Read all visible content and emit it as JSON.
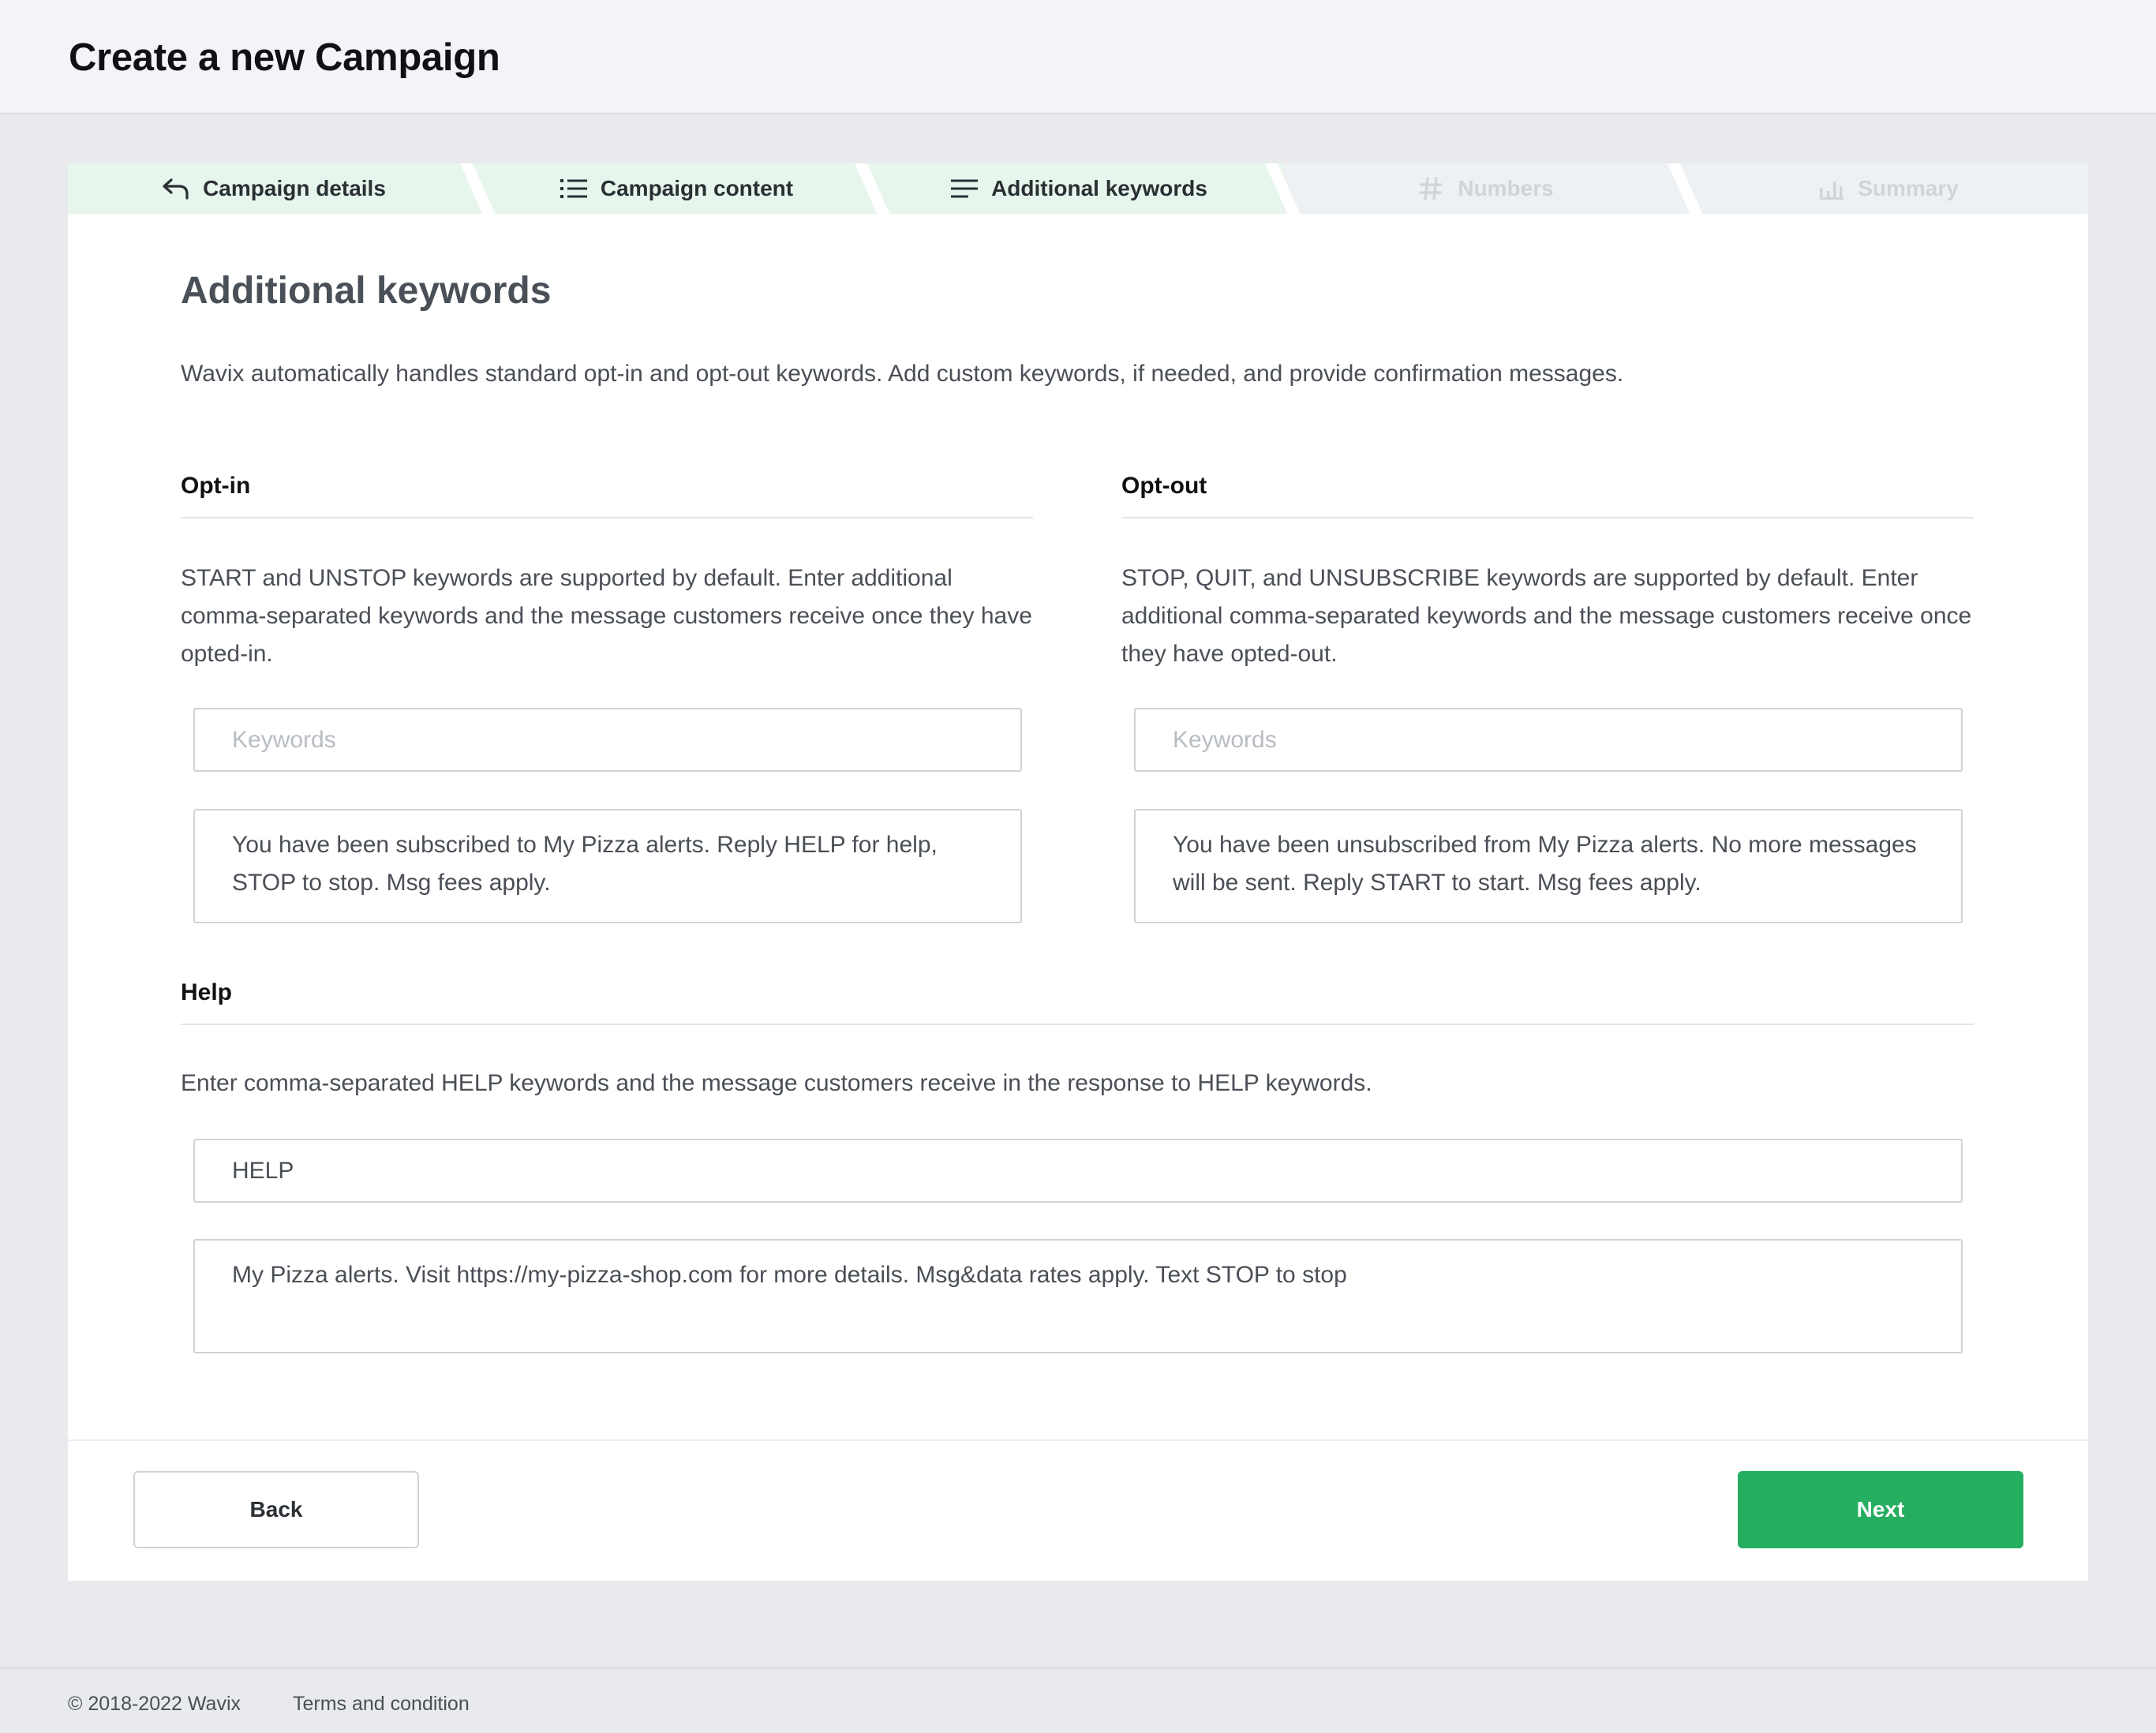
{
  "page": {
    "title": "Create a new Campaign"
  },
  "steps": [
    {
      "label": "Campaign details",
      "icon": "reply-arrow-icon",
      "state": "done"
    },
    {
      "label": "Campaign content",
      "icon": "list-icon",
      "state": "done"
    },
    {
      "label": "Additional keywords",
      "icon": "text-lines-icon",
      "state": "current"
    },
    {
      "label": "Numbers",
      "icon": "hash-icon",
      "state": "todo"
    },
    {
      "label": "Summary",
      "icon": "bar-chart-icon",
      "state": "todo"
    }
  ],
  "section": {
    "title": "Additional keywords",
    "intro": "Wavix automatically handles standard opt-in and opt-out keywords. Add custom keywords, if needed, and provide confirmation messages."
  },
  "optin": {
    "heading": "Opt-in",
    "description": "START and UNSTOP keywords are supported by default. Enter additional comma-separated keywords and the message customers receive once they have opted-in.",
    "keywords_placeholder": "Keywords",
    "keywords_value": "",
    "message": "You have been subscribed to My Pizza alerts. Reply HELP for help, STOP to stop. Msg fees apply."
  },
  "optout": {
    "heading": "Opt-out",
    "description": "STOP, QUIT, and UNSUBSCRIBE keywords are supported by default. Enter additional comma-separated keywords and the message customers receive once they have opted-out.",
    "keywords_placeholder": "Keywords",
    "keywords_value": "",
    "message": "You have been unsubscribed from My Pizza alerts. No more messages will be sent. Reply START to start. Msg fees apply."
  },
  "help": {
    "heading": "Help",
    "description": "Enter comma-separated HELP keywords and the message customers receive in the response to HELP keywords.",
    "keywords_value": "HELP",
    "message": "My Pizza alerts. Visit https://my-pizza-shop.com for more details. Msg&data rates apply. Text STOP to stop"
  },
  "actions": {
    "back_label": "Back",
    "next_label": "Next"
  },
  "colors": {
    "accent": "#25ae60",
    "step_done_bg": "#e6f6ec"
  },
  "footer": {
    "copyright": "© 2018-2022 Wavix",
    "terms": "Terms and condition"
  }
}
